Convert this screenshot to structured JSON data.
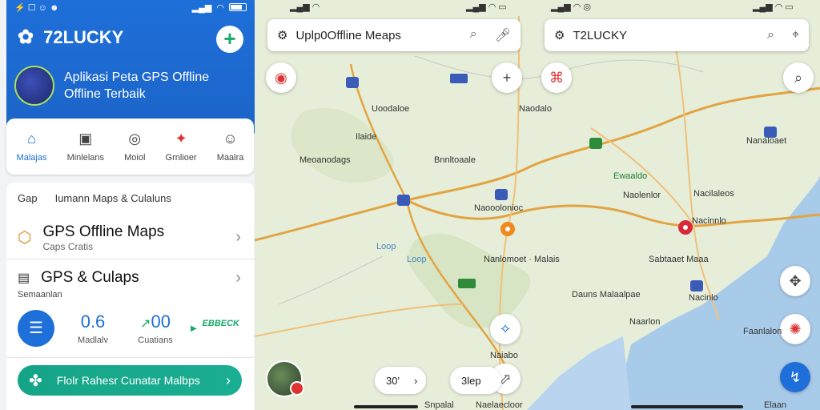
{
  "left_panel": {
    "status": {
      "time": "⚡ ☐ ☺ ☻"
    },
    "app_title": "72LUCKY",
    "add_label": "+",
    "hero_line1": "Aplikasi Peta GPS Offline",
    "hero_line2": "Offline Terbaik",
    "nav": [
      {
        "label": "Malajas",
        "icon": "⌂"
      },
      {
        "label": "Minlelans",
        "icon": "▣"
      },
      {
        "label": "Moiol",
        "icon": "◎"
      },
      {
        "label": "Grnlioer",
        "icon": "✦"
      },
      {
        "label": "Maalra",
        "icon": "☺"
      }
    ],
    "list_head_a": "Gap",
    "list_head_b": "Iumann Maps & Culaluns",
    "row1_title": "GPS Offline Maps",
    "row1_sub": "Caps Cratis",
    "row2_title": "GPS & Culaps",
    "caption2": "Semaanlan",
    "stat1_value": "0.6",
    "stat1_label": "Madlalv",
    "stat2_value": "00",
    "stat2_label": "Cuatians",
    "green_badge": "EBBECK",
    "cta_label": "Flolr Rahesr Cunatar Malbps"
  },
  "map_panel": {
    "search1": "Uplp0Offline Meaps",
    "search2": "T2LUCKY",
    "pill1": "30'",
    "pill2": "3lep",
    "labels": [
      "Uoodaloe",
      "Naodalo",
      "Ilaide",
      "Meoanodags",
      "Bnnltoaale",
      "Ewaaldo",
      "Naolenlor",
      "Nacilaleos",
      "Naooolonioc",
      "Nanaloaet",
      "Nacinnlo",
      "Loop",
      "Loop",
      "Nanlomoet · Malais",
      "Sabtaaet Maaa",
      "Dauns Malaalpae",
      "Nacinlo",
      "Naarlon",
      "Naiabo",
      "Faanlalon",
      "Snpalal",
      "Naelaecloor",
      "Elaan"
    ]
  },
  "icons": [
    "gear-icon",
    "plus-icon",
    "home-icon",
    "doc-icon",
    "search-icon",
    "pin-icon",
    "face-icon",
    "box-icon",
    "chevron-right-icon",
    "list-icon",
    "leaf-icon",
    "mic-icon",
    "compass-icon",
    "star-icon",
    "navigate-icon"
  ],
  "colors": {
    "primary": "#1e6fd9",
    "green": "#17a86b",
    "water": "#a9cbea",
    "land": "#e6eed9"
  }
}
